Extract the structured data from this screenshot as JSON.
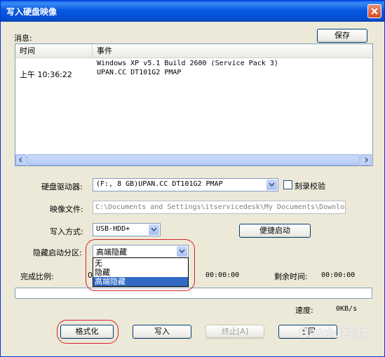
{
  "window": {
    "title": "写入硬盘映像"
  },
  "messages": {
    "label": "消息:",
    "save_label": "保存",
    "columns": [
      "时间",
      "事件"
    ],
    "rows": [
      {
        "time": "",
        "event": "Windows XP v5.1 Build 2600 (Service Pack 3)"
      },
      {
        "time": "上午 10:36:22",
        "event": "UPAN.CC DT101G2         PMAP"
      }
    ]
  },
  "form": {
    "drive_label": "硬盘驱动器:",
    "drive_value": "(F:, 8 GB)UPAN.CC DT101G2         PMAP",
    "verify_label": "刻录校验",
    "verify_checked": false,
    "image_label": "映像文件:",
    "image_value": "C:\\Documents and Settings\\itservicedesk\\My Documents\\Downlo",
    "mode_label": "写入方式:",
    "mode_value": "USB-HDD+",
    "quick_boot_label": "便捷启动",
    "hidden_label": "隐藏启动分区:",
    "hidden_value": "高端隐藏",
    "hidden_options": [
      "无",
      "隐藏",
      "高端隐藏"
    ],
    "hidden_selected_index": 2
  },
  "progress": {
    "ratio_label": "完成比例:",
    "ratio_prefix": "0",
    "elapsed_value": "00:00:00",
    "remaining_label": "剩余时间:",
    "remaining_value": "00:00:00",
    "fill_fraction": 0,
    "speed_label": "速度:",
    "speed_value": "0KB/s"
  },
  "buttons": {
    "format": "格式化",
    "write": "写入",
    "stop": "终止[A]",
    "back": "返回"
  },
  "watermark": "Baidu经验",
  "colors": {
    "highlight_ring": "#d8202a",
    "selection": "#316ac5",
    "titlebar": "#0450d6"
  }
}
